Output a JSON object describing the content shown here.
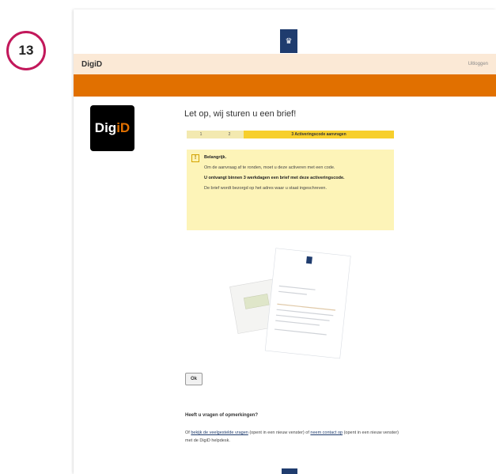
{
  "step_badge": "13",
  "header": {
    "title": "DigiD",
    "logout": "Uitloggen"
  },
  "logo": {
    "part1": "Dig",
    "part2": "iD"
  },
  "gov_logo_icon": "royal-crest-icon",
  "page_title": "Let op, wij sturen u een brief!",
  "progress": {
    "step1": "1",
    "step2": "2",
    "step3": "3 Activeringscode aanvragen"
  },
  "notice": {
    "icon": "!",
    "heading": "Belangrijk.",
    "paragraph1": "Om de aanvraag af te ronden, moet u deze activeren met een code.",
    "paragraph2": "U ontvangt binnen 3 werkdagen een brief met deze activeringscode.",
    "paragraph3": "De brief wordt bezorgd op het adres waar u staat ingeschreven."
  },
  "ok_button": "Ok",
  "questions": {
    "title": "Heeft u vragen of opmerkingen?",
    "prefix": "Of ",
    "faq_link": "bekijk de veelgestelde vragen",
    "middle": " (opent in een nieuw venster) of ",
    "contact_link": "neem contact op",
    "suffix": " (opent in een nieuw venster) met de DigiD helpdesk."
  },
  "colors": {
    "brand_orange": "#e17000",
    "header_bg": "#fbe9d6",
    "notice_bg": "#fdf4b8",
    "progress_active": "#f7cf2c",
    "badge_ring": "#c2185b",
    "gov_blue": "#1f3c6e"
  }
}
